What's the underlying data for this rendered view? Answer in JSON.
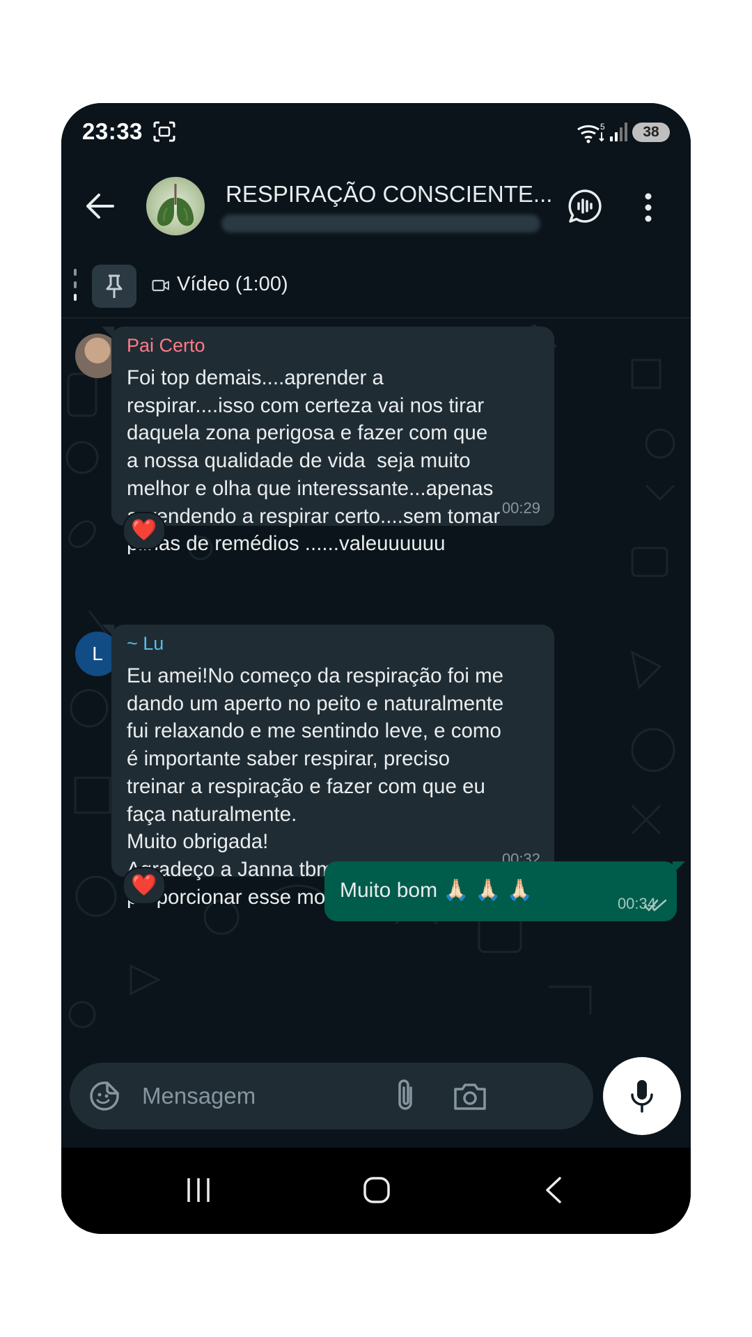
{
  "status_bar": {
    "time": "23:33",
    "battery": "38",
    "wifi_badge": "5",
    "icons": [
      "screenshot-icon",
      "wifi-icon",
      "signal-icon",
      "battery-icon"
    ]
  },
  "header": {
    "group_name": "RESPIRAÇÃO CONSCIENTE...",
    "icons": [
      "back-arrow-icon",
      "voice-chat-icon",
      "more-vert-icon"
    ]
  },
  "pinned": {
    "label": "Vídeo (1:00)",
    "icons": [
      "pin-icon",
      "video-icon"
    ]
  },
  "messages": [
    {
      "sender": "Pai Certo",
      "sender_color": "#ff7b89",
      "text": "Foi top demais....aprender a\nrespirar....isso com certeza vai nos tirar\ndaquela zona perigosa e fazer com que\na nossa qualidade de vida  seja muito\nmelhor e olha que interessante...apenas\naprendendo a respirar certo....sem tomar\npilhas de remédios ......valeuuuuuu",
      "time": "00:29",
      "reaction": "❤️"
    },
    {
      "sender": "~ Lu",
      "sender_color": "#53bdeb",
      "avatar_initial": "L",
      "text": "Eu amei!No começo da respiração foi me\ndando um aperto no peito e naturalmente\nfui relaxando e me sentindo leve, e como\né importante saber respirar, preciso\ntreinar a respiração e fazer com que eu\nfaça naturalmente.\nMuito obrigada!\nAgradeço a Janna tbm por me\nproporcionar esse momento!",
      "time": "00:32",
      "reaction": "❤️"
    },
    {
      "outgoing": true,
      "text": "Muito bom 🙏🏻 🙏🏻 🙏🏻",
      "time": "00:34",
      "status_icon": "double-check-icon"
    }
  ],
  "input": {
    "placeholder": "Mensagem",
    "icons": [
      "sticker-icon",
      "attach-icon",
      "camera-icon",
      "mic-icon"
    ]
  },
  "colors": {
    "background": "#0b141a",
    "bubble_incoming": "#202c33",
    "bubble_outgoing": "#005c4b",
    "text": "#e9edef",
    "muted": "#8696a0"
  }
}
